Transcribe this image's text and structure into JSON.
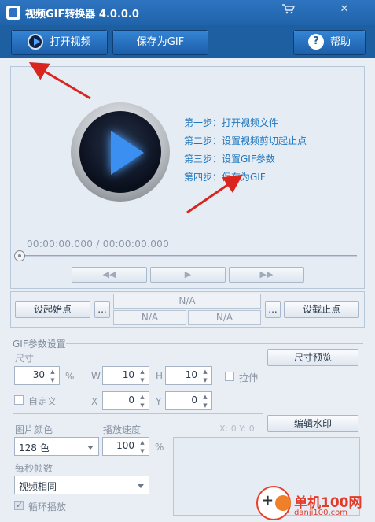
{
  "window": {
    "title": "视频GIF转换器 4.0.0.0",
    "cart_icon": "cart-icon",
    "minimize": "—",
    "close": "✕"
  },
  "toolbar": {
    "open_video": "打开视频",
    "save_gif": "保存为GIF",
    "help": "帮助"
  },
  "preview": {
    "steps": [
      "第一步：打开视频文件",
      "第二步：设置视频剪切起止点",
      "第三步：设置GIF参数",
      "第四步：保存为GIF"
    ],
    "timecode": "00:00:00.000 / 00:00:00.000",
    "controls": {
      "prev": "◀◀",
      "play": "▶",
      "next": "▶▶"
    }
  },
  "trim": {
    "set_start": "设起始点",
    "set_end": "设截止点",
    "browse": "...",
    "duration": "N/A",
    "start_value": "N/A",
    "end_value": "N/A"
  },
  "gif_settings": {
    "section_title": "GIF参数设置",
    "size_label": "尺寸",
    "size_value": "30",
    "size_unit": "%",
    "w_label": "W",
    "w_value": "10",
    "h_label": "H",
    "h_value": "10",
    "stretch_label": "拉伸",
    "stretch_checked": false,
    "size_preview": "尺寸预览",
    "custom_label": "自定义",
    "custom_checked": false,
    "x_label": "X",
    "x_value": "0",
    "y_label": "Y",
    "y_value": "0",
    "colors_label": "图片颜色",
    "colors_value": "128 色",
    "speed_label": "播放速度",
    "speed_value": "100",
    "speed_unit": "%",
    "edit_watermark": "编辑水印",
    "coords": "X: 0  Y: 0",
    "fps_label": "每秒帧数",
    "fps_value": "视频相同",
    "loop_label": "循环播放",
    "loop_checked": true
  },
  "watermark": {
    "site": "单机100网",
    "domain": "danji100.com"
  },
  "colors": {
    "title_bar": "#2f74c0",
    "accent_text": "#1e76be",
    "arrow": "#d9251d"
  }
}
